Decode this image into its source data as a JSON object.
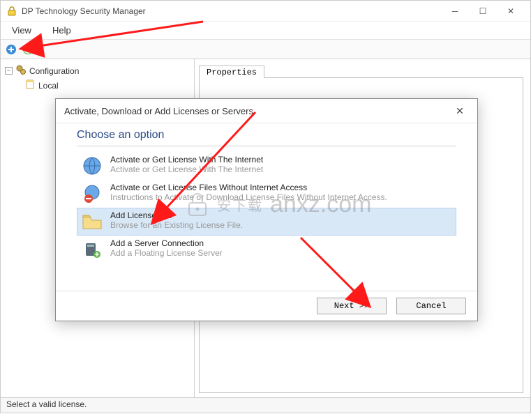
{
  "window": {
    "title": "DP Technology Security Manager"
  },
  "menubar": {
    "items": [
      "View",
      "Help"
    ]
  },
  "sidebar": {
    "root": {
      "label": "Configuration"
    },
    "children": [
      {
        "label": "Local"
      }
    ]
  },
  "main": {
    "tabs": [
      {
        "label": "Properties"
      }
    ]
  },
  "statusbar": {
    "text": "Select a valid license."
  },
  "dialog": {
    "title": "Activate, Download or Add Licenses or Servers",
    "heading": "Choose an option",
    "options": [
      {
        "title": "Activate or Get License With The Internet",
        "sub": "Activate or Get License With The Internet"
      },
      {
        "title": "Activate or Get License Files Without Internet Access",
        "sub": "Instructions to Activate or Download License Files Without Internet Access."
      },
      {
        "title": "Add License File",
        "sub": "Browse for an Existing License File."
      },
      {
        "title": "Add a Server Connection",
        "sub": "Add a Floating License Server"
      }
    ],
    "buttons": {
      "next": "Next >>",
      "cancel": "Cancel"
    }
  },
  "watermark": {
    "text": "anxz.com"
  }
}
